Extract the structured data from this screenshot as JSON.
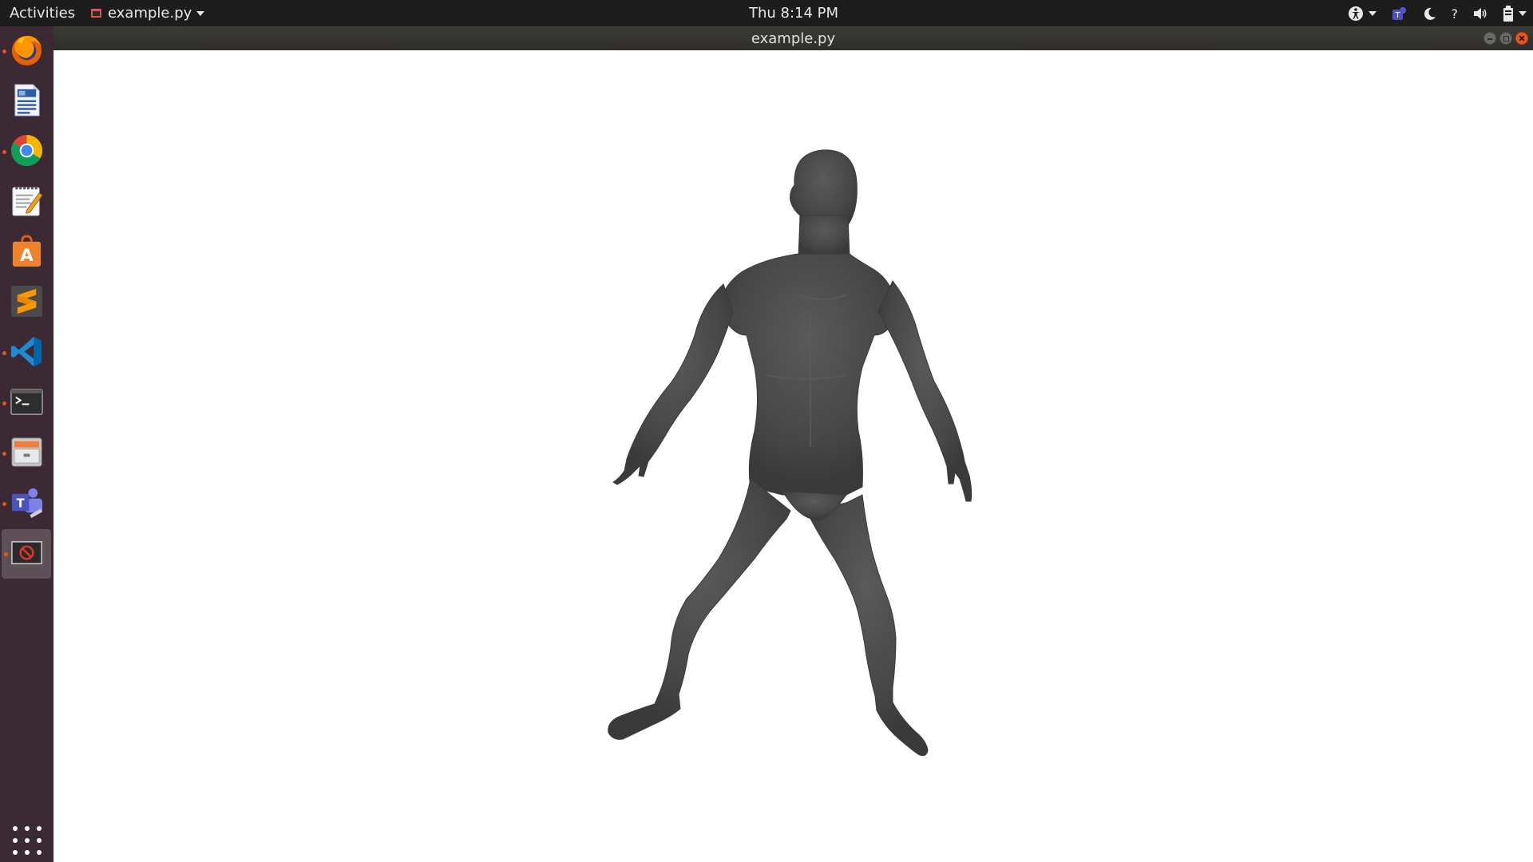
{
  "topbar": {
    "activities_label": "Activities",
    "app_menu_label": "example.py",
    "clock": "Thu  8:14 PM",
    "tray_icons": [
      "accessibility-icon",
      "teams-tray-icon",
      "night-light-icon",
      "help-icon",
      "volume-icon",
      "battery-icon"
    ],
    "help_glyph": "?"
  },
  "window": {
    "title": "example.py",
    "controls": [
      "minimize",
      "maximize",
      "close"
    ]
  },
  "dock": {
    "items": [
      {
        "name": "firefox",
        "running": true
      },
      {
        "name": "libreoffice-writer",
        "running": false
      },
      {
        "name": "chrome",
        "running": true
      },
      {
        "name": "text-editor",
        "running": false
      },
      {
        "name": "ubuntu-software",
        "running": false
      },
      {
        "name": "sublime-text",
        "running": false
      },
      {
        "name": "vscode",
        "running": true
      },
      {
        "name": "terminal",
        "running": true
      },
      {
        "name": "file-manager",
        "running": true
      },
      {
        "name": "microsoft-teams",
        "running": true
      },
      {
        "name": "example-py-window",
        "running": true,
        "active": true
      }
    ],
    "show_apps_label": "Show Applications"
  },
  "viewer": {
    "background": "#ffffff",
    "model_color": "#4a4a4a",
    "content": "3d-human-body-mesh"
  },
  "colors": {
    "topbar": "#1d1d1d",
    "dock": "#3b2a33",
    "accent": "#e95420"
  }
}
